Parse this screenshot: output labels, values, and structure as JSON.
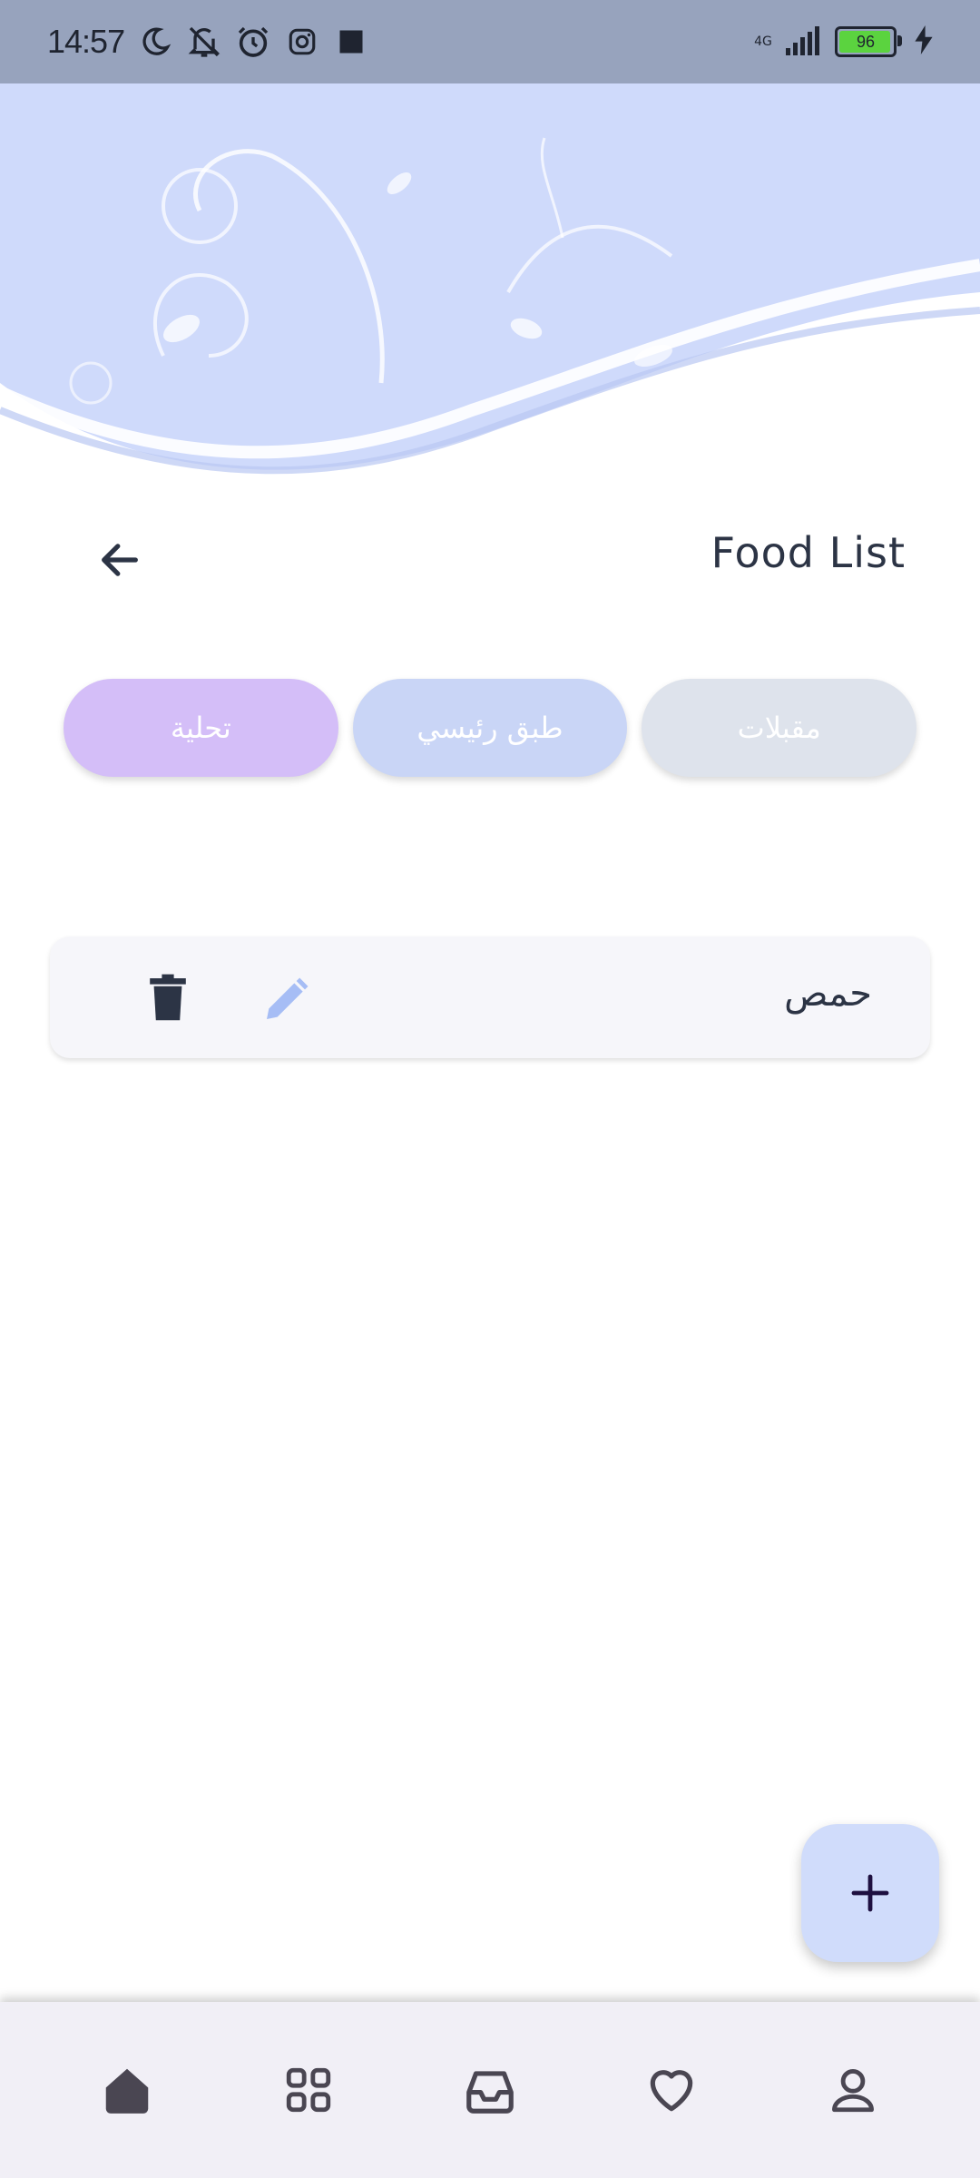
{
  "status_bar": {
    "time": "14:57",
    "network": "4G",
    "battery_level": "96",
    "battery_fraction": 0.96,
    "icons": [
      "moon-icon",
      "mute-icon",
      "alarm-icon",
      "instagram-icon",
      "square-icon",
      "signal-icon",
      "battery-icon",
      "charging-icon"
    ]
  },
  "header": {
    "title": "Food List",
    "back_icon": "arrow-left-icon"
  },
  "categories": [
    {
      "label": "مقبلات",
      "color": "#dee3ec"
    },
    {
      "label": "طبق رئيسي",
      "color": "#c9d5f6"
    },
    {
      "label": "تحلية",
      "color": "#d4bef8"
    }
  ],
  "foods": [
    {
      "name": "حمص",
      "edit_icon": "pencil-icon",
      "delete_icon": "trash-icon"
    }
  ],
  "fab": {
    "icon": "plus-icon"
  },
  "bottom_nav": {
    "items": [
      "home-icon",
      "grid-icon",
      "inbox-icon",
      "heart-icon",
      "profile-icon"
    ]
  },
  "colors": {
    "status_bar": "#97a3bd",
    "banner": "#cfdafb",
    "text": "#2c3445",
    "edit_icon": "#a6bdf5",
    "fab": "#d0dcfb",
    "nav": "#f1eff6"
  }
}
